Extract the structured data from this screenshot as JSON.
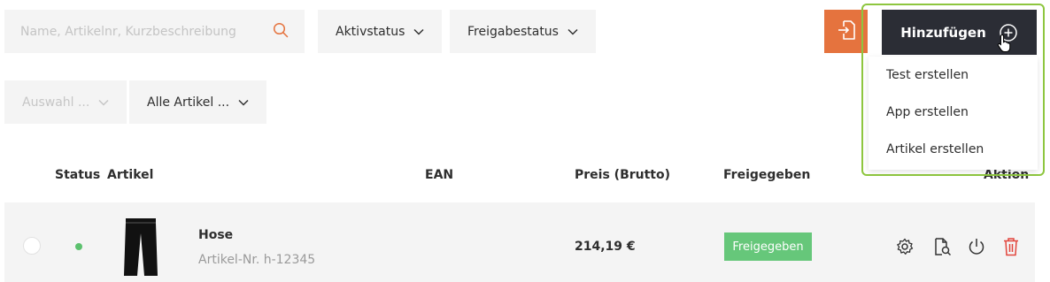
{
  "search": {
    "placeholder": "Name, Artikelnr, Kurzbeschreibung",
    "icon": "search-icon"
  },
  "filters": {
    "active_status": "Aktivstatus",
    "release_status": "Freigabestatus",
    "selection": "Auswahl ...",
    "all_articles": "Alle Artikel ..."
  },
  "toolbar": {
    "import_icon": "import-icon",
    "add_label": "Hinzufügen",
    "add_icon": "plus-circle-icon"
  },
  "add_menu": {
    "items": [
      "Test erstellen",
      "App erstellen",
      "Artikel erstellen"
    ]
  },
  "table": {
    "headers": {
      "status": "Status",
      "article": "Artikel",
      "ean": "EAN",
      "price": "Preis (Brutto)",
      "released": "Freigegeben",
      "action": "Aktion"
    },
    "rows": [
      {
        "name": "Hose",
        "sku": "Artikel-Nr. h-12345",
        "ean": "",
        "price": "214,19 €",
        "released": "Freigegeben",
        "status": "active",
        "image": "trousers",
        "actions": [
          "settings-icon",
          "preview-document-icon",
          "power-icon",
          "trash-icon"
        ]
      }
    ]
  },
  "colors": {
    "accent": "#e5733e",
    "dark": "#2b2d35",
    "success": "#66c77a",
    "status_dot": "#5cc16e",
    "highlight": "#8ec63f",
    "danger": "#e2453c"
  }
}
